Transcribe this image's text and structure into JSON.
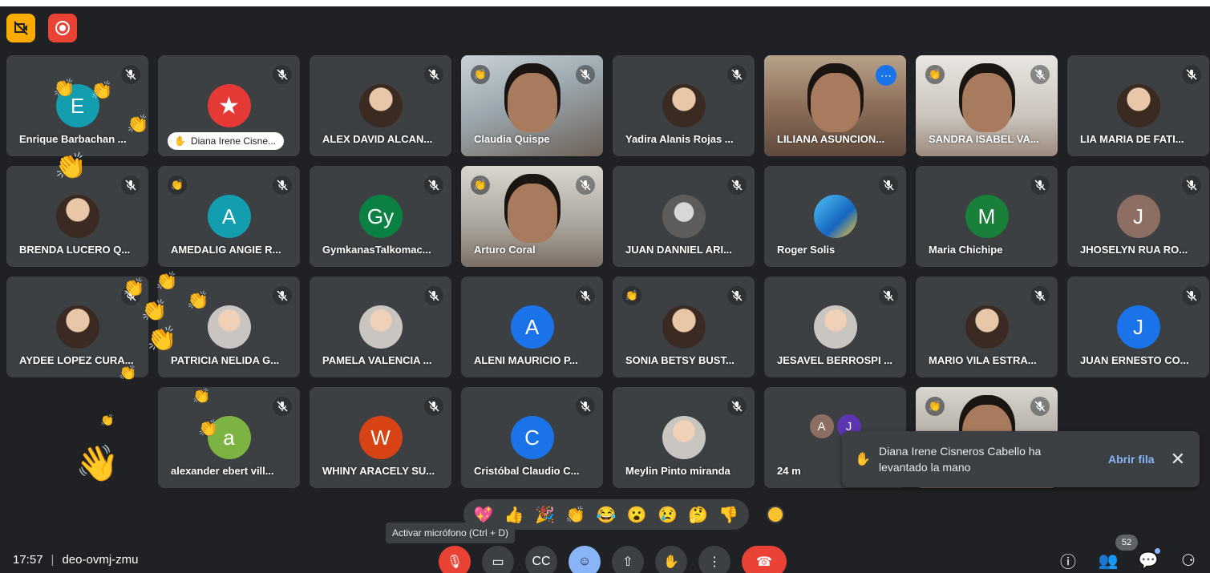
{
  "colors": {
    "background": "#202124",
    "tile": "#3c4043",
    "accent_blue": "#8ab4f8",
    "danger_red": "#ea4335",
    "recording_yellow": "#f9ab00"
  },
  "top_icons": [
    {
      "name": "no-video-recording-icon",
      "glyph": "⧄"
    },
    {
      "name": "record-icon",
      "glyph": "◉"
    }
  ],
  "participants": [
    {
      "name": "Enrique Barbachan ...",
      "type": "letter",
      "letter": "E",
      "color": "#129eaf",
      "muted": true
    },
    {
      "name": "Diana Irene Cisne...",
      "type": "logo",
      "muted": true,
      "pill": true,
      "hand": "✋"
    },
    {
      "name": "ALEX DAVID ALCAN...",
      "type": "photo",
      "muted": true
    },
    {
      "name": "Claudia Quispe",
      "type": "video",
      "bg": "vb1",
      "muted": true,
      "hand": "👏"
    },
    {
      "name": "Yadira Alanis Rojas ...",
      "type": "photo",
      "muted": true
    },
    {
      "name": "LILIANA ASUNCION...",
      "type": "video",
      "bg": "vb2",
      "active": true,
      "more": "⋯"
    },
    {
      "name": "SANDRA ISABEL VA...",
      "type": "video",
      "bg": "vb3",
      "muted": true,
      "hand": "👏"
    },
    {
      "name": "LIA MARIA DE FATI...",
      "type": "photo",
      "muted": true
    },
    {
      "name": "BRENDA LUCERO Q...",
      "type": "photo",
      "muted": true
    },
    {
      "name": "AMEDALIG ANGIE R...",
      "type": "letter",
      "letter": "A",
      "color": "#129eaf",
      "muted": true,
      "hand": "👏"
    },
    {
      "name": "GymkanasTalkomac...",
      "type": "letter",
      "letter": "Gy",
      "color": "#0b8043",
      "muted": true
    },
    {
      "name": "Arturo Coral",
      "type": "video",
      "bg": "vb4",
      "muted": true,
      "hand": "👏"
    },
    {
      "name": "JUAN DANNIEL ARI...",
      "type": "photo-bw",
      "muted": true
    },
    {
      "name": "Roger Solis",
      "type": "logo-blue",
      "muted": true
    },
    {
      "name": "Maria Chichipe",
      "type": "letter",
      "letter": "M",
      "color": "#188038",
      "muted": true
    },
    {
      "name": "JHOSELYN RUA RO...",
      "type": "letter",
      "letter": "J",
      "color": "#8d6e63",
      "muted": true
    },
    {
      "name": "AYDEE LOPEZ CURA...",
      "type": "photo",
      "muted": true
    },
    {
      "name": "PATRICIA NELIDA G...",
      "type": "photo-light",
      "muted": true
    },
    {
      "name": "PAMELA VALENCIA ...",
      "type": "photo-light",
      "muted": true
    },
    {
      "name": "ALENI MAURICIO P...",
      "type": "letter",
      "letter": "A",
      "color": "#1a73e8",
      "muted": true
    },
    {
      "name": "SONIA BETSY BUST...",
      "type": "photo",
      "muted": true,
      "hand": "👏"
    },
    {
      "name": "JESAVEL BERROSPI ...",
      "type": "photo-light",
      "muted": true
    },
    {
      "name": "MARIO VILA ESTRA...",
      "type": "photo",
      "muted": true
    },
    {
      "name": "JUAN ERNESTO CO...",
      "type": "letter",
      "letter": "J",
      "color": "#1a73e8",
      "muted": true
    },
    {
      "name": "",
      "type": "empty"
    },
    {
      "name": "alexander ebert vill...",
      "type": "letter",
      "letter": "a",
      "color": "#7cb342",
      "muted": true
    },
    {
      "name": "WHINY ARACELY SU...",
      "type": "letter",
      "letter": "W",
      "color": "#d84315",
      "muted": true
    },
    {
      "name": "Cristóbal Claudio C...",
      "type": "letter",
      "letter": "C",
      "color": "#1a73e8",
      "muted": true
    },
    {
      "name": "Meylin Pinto miranda",
      "type": "photo-light",
      "muted": true
    },
    {
      "name": "24 m",
      "type": "multi",
      "letters": [
        "A",
        "J"
      ],
      "letter_colors": [
        "#8d6e63",
        "#5e35b1"
      ]
    },
    {
      "name": "",
      "type": "video",
      "bg": "vb4",
      "muted": true,
      "hand": "👏"
    }
  ],
  "reactions": [
    "💖",
    "👍",
    "🎉",
    "👏",
    "😂",
    "😮",
    "😢",
    "🤔",
    "👎"
  ],
  "tooltip": "Activar micrófono (Ctrl + D)",
  "toast": {
    "message": "Diana Irene Cisneros Cabello ha levantado la mano",
    "action": "Abrir fila",
    "hand_icon": "✋",
    "close_icon": "✕"
  },
  "meeting": {
    "time": "17:57",
    "separator": "|",
    "code": "deo-ovmj-zmu"
  },
  "controls": [
    {
      "name": "microphone-off-button",
      "glyph": "🎙",
      "style": "red"
    },
    {
      "name": "camera-button",
      "glyph": "▭",
      "style": ""
    },
    {
      "name": "captions-button",
      "glyph": "CC",
      "style": ""
    },
    {
      "name": "reactions-button",
      "glyph": "☺",
      "style": "blue"
    },
    {
      "name": "present-button",
      "glyph": "⇧",
      "style": ""
    },
    {
      "name": "raise-hand-button",
      "glyph": "✋",
      "style": ""
    },
    {
      "name": "more-options-button",
      "glyph": "⋮",
      "style": ""
    },
    {
      "name": "leave-call-button",
      "glyph": "☎",
      "style": "end"
    }
  ],
  "right_icons": {
    "info": "ⓘ",
    "people": "👥",
    "people_count": "52",
    "chat": "💬",
    "activities": "⚆"
  },
  "mute_icon": "🔇"
}
